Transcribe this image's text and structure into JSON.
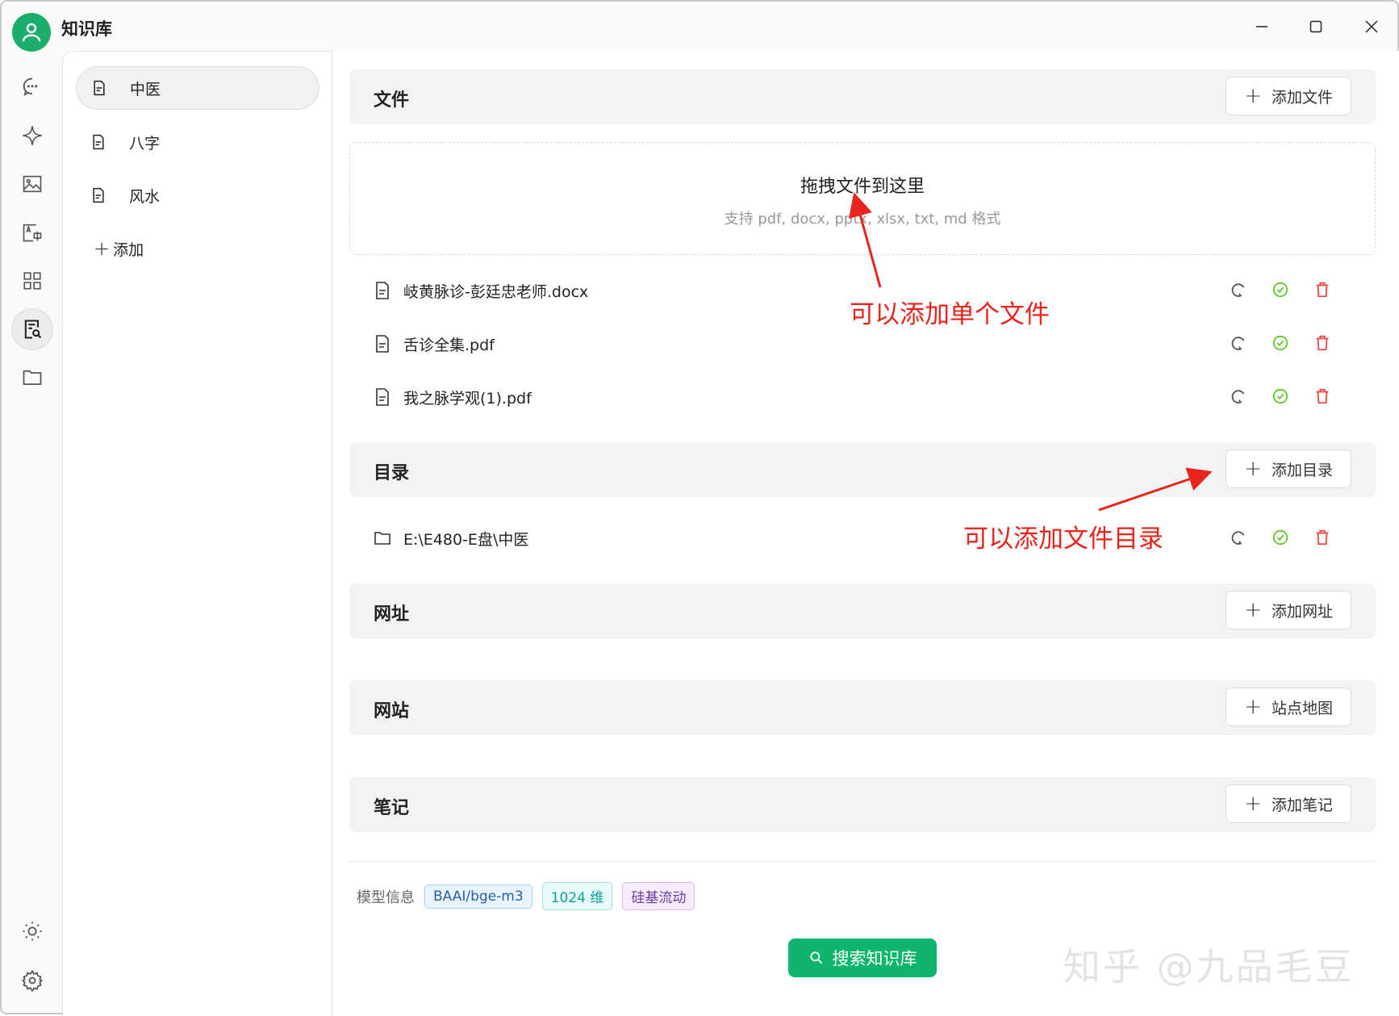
{
  "window": {
    "title": "知识库",
    "controls": [
      "minimize",
      "maximize",
      "close"
    ]
  },
  "rail": [
    "chat-icon",
    "sparkle-icon",
    "image-icon",
    "translate-icon",
    "apps-icon",
    "knowledge-icon",
    "folder-icon",
    "sun-icon",
    "settings-icon"
  ],
  "knowledge_bases": [
    {
      "label": "中医",
      "selected": true
    },
    {
      "label": "八字"
    },
    {
      "label": "风水"
    }
  ],
  "add_kb_label": "添加",
  "sections": {
    "files": {
      "title": "文件",
      "button": "添加文件",
      "drop_title": "拖拽文件到这里",
      "drop_hint": "支持 pdf, docx, pptx, xlsx, txt, md 格式",
      "items": [
        "岐黄脉诊-彭廷忠老师.docx",
        "舌诊全集.pdf",
        "我之脉学观(1).pdf"
      ]
    },
    "directories": {
      "title": "目录",
      "button": "添加目录",
      "items": [
        "E:\\E480-E盘\\中医"
      ]
    },
    "urls": {
      "title": "网址",
      "button": "添加网址"
    },
    "sites": {
      "title": "网站",
      "button": "站点地图"
    },
    "notes": {
      "title": "笔记",
      "button": "添加笔记"
    }
  },
  "model_info": {
    "label": "模型信息",
    "tags": [
      "BAAI/bge-m3",
      "1024 维",
      "硅基流动"
    ]
  },
  "search_button": "搜索知识库",
  "annotations": {
    "single_file": "可以添加单个文件",
    "directory": "可以添加文件目录"
  },
  "watermark": "知乎 @九品毛豆",
  "colors": {
    "accent": "#0fb56c",
    "annotation": "#e8241c",
    "ok": "#52c41a",
    "danger": "#ef4444"
  }
}
